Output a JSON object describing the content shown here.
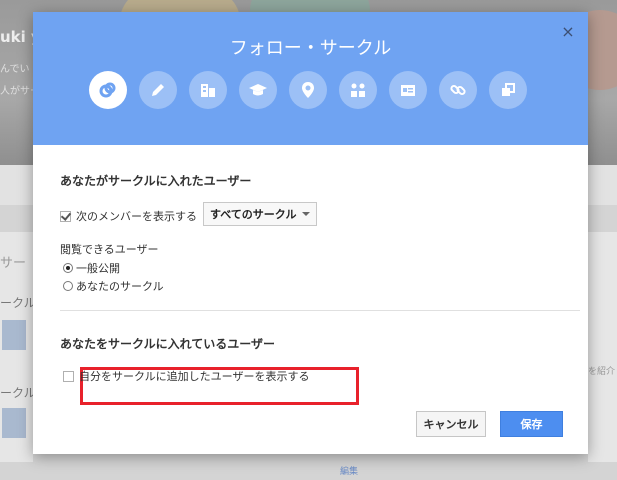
{
  "background": {
    "name_fragment": "uki y",
    "line1_fragment": "んでい",
    "line2_fragment": "人がサー",
    "left_text1": "サー",
    "left_text2": "ークル",
    "left_text3": "ークル",
    "right_text": "を紹介",
    "bottom_link": "編集"
  },
  "dialog": {
    "title": "フォロー・サークル",
    "close_label": "×",
    "category_icons": [
      {
        "name": "links-icon",
        "active": true
      },
      {
        "name": "pencil-icon",
        "active": false
      },
      {
        "name": "building-icon",
        "active": false
      },
      {
        "name": "graduation-cap-icon",
        "active": false
      },
      {
        "name": "location-pin-icon",
        "active": false
      },
      {
        "name": "people-icon",
        "active": false
      },
      {
        "name": "id-card-icon",
        "active": false
      },
      {
        "name": "chain-link-icon",
        "active": false
      },
      {
        "name": "overlap-squares-icon",
        "active": false
      }
    ],
    "section1": {
      "title": "あなたがサークルに入れたユーザー",
      "show_members_label": "次のメンバーを表示する",
      "show_members_checked": true,
      "circle_select_value": "すべてのサークル",
      "visibility_label": "閲覧できるユーザー",
      "radio_public": "一般公開",
      "radio_public_checked": true,
      "radio_circles": "あなたのサークル"
    },
    "section2": {
      "title": "あなたをサークルに入れているユーザー",
      "show_adders_label": "自分をサークルに追加したユーザーを表示する",
      "show_adders_checked": false
    },
    "buttons": {
      "cancel": "キャンセル",
      "save": "保存"
    }
  },
  "colors": {
    "header_bg": "#6fa3f2",
    "icon_circle": "#9cc0f6",
    "save_button": "#4d8ef0",
    "highlight_border": "#e8212b"
  }
}
